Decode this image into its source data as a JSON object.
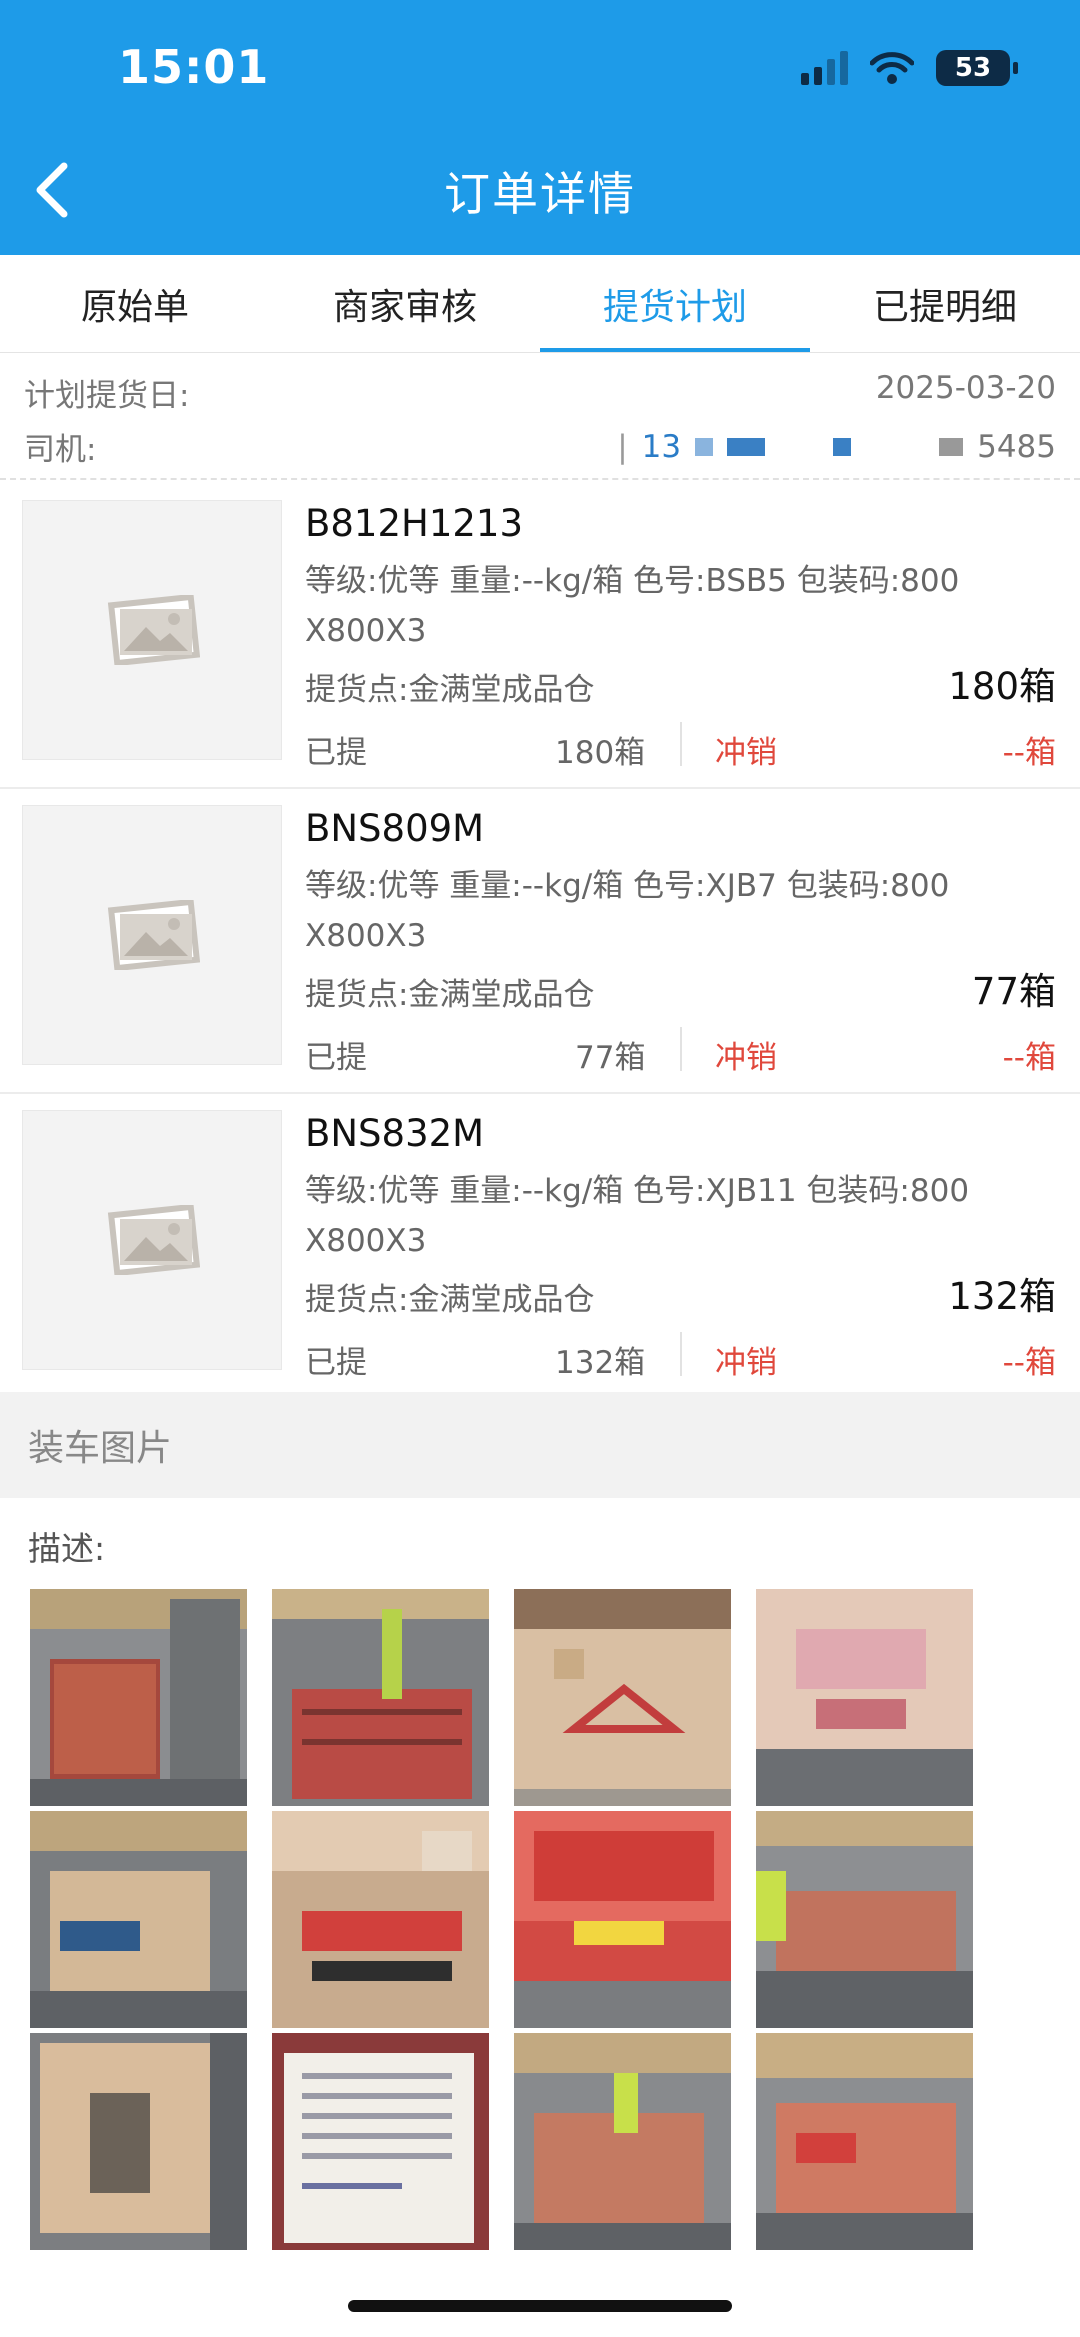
{
  "status_bar": {
    "time": "15:01",
    "battery": "53"
  },
  "header": {
    "title": "订单详情"
  },
  "tabs": [
    {
      "label": "原始单",
      "active": false
    },
    {
      "label": "商家审核",
      "active": false
    },
    {
      "label": "提货计划",
      "active": true
    },
    {
      "label": "已提明细",
      "active": false
    }
  ],
  "plan": {
    "date_label": "计划提货日:",
    "date_value": "2025-03-20",
    "driver_label": "司机:",
    "driver_visible_start": "13",
    "driver_visible_end": "5485"
  },
  "items": [
    {
      "code": "B812H1213",
      "spec_line1": "等级:优等    重量:--kg/箱    色号:BSB5    包装码:800",
      "spec_line2": "X800X3",
      "location": "提货点:金满堂成品仓",
      "quantity": "180箱",
      "taken_label": "已提",
      "taken_value": "180箱",
      "writeoff_label": "冲销",
      "writeoff_value": "--箱"
    },
    {
      "code": "BNS809M",
      "spec_line1": "等级:优等    重量:--kg/箱    色号:XJB7    包装码:800",
      "spec_line2": "X800X3",
      "location": "提货点:金满堂成品仓",
      "quantity": "77箱",
      "taken_label": "已提",
      "taken_value": "77箱",
      "writeoff_label": "冲销",
      "writeoff_value": "--箱"
    },
    {
      "code": "BNS832M",
      "spec_line1": "等级:优等    重量:--kg/箱    色号:XJB11    包装码:800",
      "spec_line2": "X800X3",
      "location": "提货点:金满堂成品仓",
      "quantity": "132箱",
      "taken_label": "已提",
      "taken_value": "132箱",
      "writeoff_label": "冲销",
      "writeoff_value": "--箱"
    }
  ],
  "loading_section": {
    "title": "装车图片",
    "description_label": "描述:"
  },
  "colors": {
    "primary": "#1e9be8",
    "writeoff": "#e0483c"
  }
}
